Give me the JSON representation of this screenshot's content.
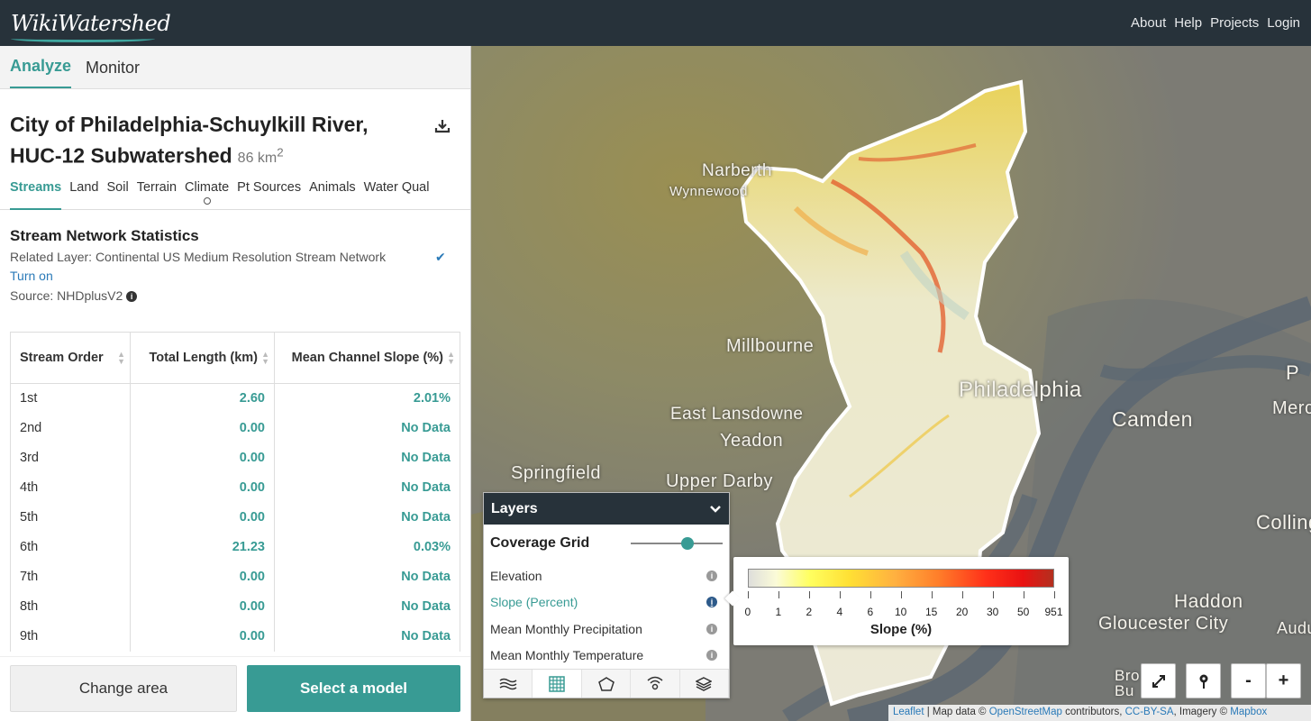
{
  "header": {
    "logo": "WikiWatershed",
    "nav": [
      "About",
      "Help",
      "Projects",
      "Login"
    ]
  },
  "sidebar": {
    "main_tabs": [
      "Analyze",
      "Monitor"
    ],
    "title": "City of Philadelphia-Schuylkill River, HUC-12 Subwatershed",
    "area": "86 km",
    "area_sup": "2",
    "sub_tabs": [
      "Streams",
      "Land",
      "Soil",
      "Terrain",
      "Climate",
      "Pt Sources",
      "Animals",
      "Water Qual"
    ],
    "stats_heading": "Stream Network Statistics",
    "related_layer": "Related Layer: Continental US Medium Resolution Stream Network",
    "turn_on": "Turn on",
    "source": "Source: NHDplusV2",
    "table": {
      "headers": [
        "Stream Order",
        "Total Length (km)",
        "Mean Channel Slope (%)"
      ],
      "rows": [
        [
          "1st",
          "2.60",
          "2.01%"
        ],
        [
          "2nd",
          "0.00",
          "No Data"
        ],
        [
          "3rd",
          "0.00",
          "No Data"
        ],
        [
          "4th",
          "0.00",
          "No Data"
        ],
        [
          "5th",
          "0.00",
          "No Data"
        ],
        [
          "6th",
          "21.23",
          "0.03%"
        ],
        [
          "7th",
          "0.00",
          "No Data"
        ],
        [
          "8th",
          "0.00",
          "No Data"
        ],
        [
          "9th",
          "0.00",
          "No Data"
        ]
      ]
    },
    "change_area": "Change area",
    "select_model": "Select a model"
  },
  "map": {
    "place_labels": [
      "Narberth",
      "Wynnewood",
      "Millbourne",
      "Philadelphia",
      "East Lansdowne",
      "Yeadon",
      "Springfield",
      "Upper Darby",
      "Camden",
      "Merch",
      "Collings",
      "Haddon",
      "Gloucester City",
      "Audub",
      "Bro",
      "Bu",
      "P"
    ],
    "layers_panel": {
      "title": "Layers",
      "coverage_grid": "Coverage Grid",
      "opacity": 0.62,
      "items": [
        "Elevation",
        "Slope (Percent)",
        "Mean Monthly Precipitation",
        "Mean Monthly Temperature"
      ],
      "active_item": "Slope (Percent)"
    },
    "legend": {
      "ticks": [
        "0",
        "1",
        "2",
        "4",
        "6",
        "10",
        "15",
        "20",
        "30",
        "50",
        "951"
      ],
      "title": "Slope (%)"
    },
    "attribution": {
      "leaflet": "Leaflet",
      "map_data": " | Map data © ",
      "osm": "OpenStreetMap",
      "contributors": " contributors, ",
      "license": "CC-BY-SA",
      "imagery": ", Imagery © ",
      "mapbox": "Mapbox"
    },
    "controls": {
      "zoom_in": "+",
      "zoom_out": "-"
    }
  }
}
